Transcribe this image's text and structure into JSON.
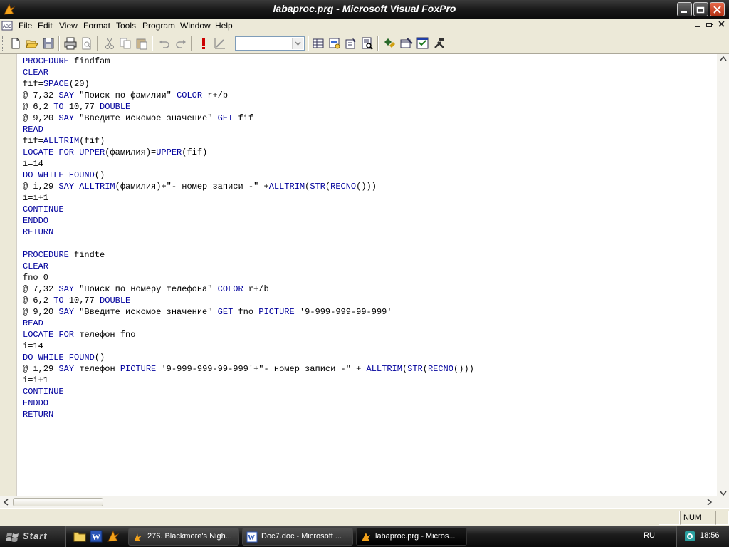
{
  "window": {
    "title": "labaproc.prg - Microsoft Visual FoxPro"
  },
  "menu": [
    "File",
    "Edit",
    "View",
    "Format",
    "Tools",
    "Program",
    "Window",
    "Help"
  ],
  "toolbar": {
    "icons": [
      "new-icon",
      "open-icon",
      "save-icon",
      "print-icon",
      "print-preview-icon",
      "cut-icon",
      "copy-icon",
      "paste-icon",
      "undo-icon",
      "redo-icon",
      "run-icon",
      "modify-form-icon",
      "database-icon",
      "form-wizard-icon",
      "report-icon",
      "report-preview-icon",
      "code-window-icon",
      "data-session-icon",
      "form-icon",
      "tools-icon"
    ],
    "combo_value": ""
  },
  "code": [
    [
      [
        "kw",
        "PROCEDURE"
      ],
      [
        "t",
        " findfam"
      ]
    ],
    [
      [
        "kw",
        "CLEAR"
      ]
    ],
    [
      [
        "t",
        "fif="
      ],
      [
        "kw",
        "SPACE"
      ],
      [
        "t",
        "(20)"
      ]
    ],
    [
      [
        "t",
        "@ 7,32 "
      ],
      [
        "kw",
        "SAY"
      ],
      [
        "t",
        " \"Поиск по фамилии\" "
      ],
      [
        "kw",
        "COLOR"
      ],
      [
        "t",
        " r+/b"
      ]
    ],
    [
      [
        "t",
        "@ 6,2 "
      ],
      [
        "kw",
        "TO"
      ],
      [
        "t",
        " 10,77 "
      ],
      [
        "kw",
        "DOUBLE"
      ]
    ],
    [
      [
        "t",
        "@ 9,20 "
      ],
      [
        "kw",
        "SAY"
      ],
      [
        "t",
        " \"Введите искомое значение\" "
      ],
      [
        "kw",
        "GET"
      ],
      [
        "t",
        " fif"
      ]
    ],
    [
      [
        "kw",
        "READ"
      ]
    ],
    [
      [
        "t",
        "fif="
      ],
      [
        "kw",
        "ALLTRIM"
      ],
      [
        "t",
        "(fif)"
      ]
    ],
    [
      [
        "kw",
        "LOCATE FOR UPPER"
      ],
      [
        "t",
        "(фамилия)="
      ],
      [
        "kw",
        "UPPER"
      ],
      [
        "t",
        "(fif)"
      ]
    ],
    [
      [
        "t",
        "i=14"
      ]
    ],
    [
      [
        "kw",
        "DO WHILE FOUND"
      ],
      [
        "t",
        "()"
      ]
    ],
    [
      [
        "t",
        "@ i,29 "
      ],
      [
        "kw",
        "SAY ALLTRIM"
      ],
      [
        "t",
        "(фамилия)+\"- номер записи -\" +"
      ],
      [
        "kw",
        "ALLTRIM"
      ],
      [
        "t",
        "("
      ],
      [
        "kw",
        "STR"
      ],
      [
        "t",
        "("
      ],
      [
        "kw",
        "RECNO"
      ],
      [
        "t",
        "()))"
      ]
    ],
    [
      [
        "t",
        "i=i+1"
      ]
    ],
    [
      [
        "kw",
        "CONTINUE"
      ]
    ],
    [
      [
        "kw",
        "ENDDO"
      ]
    ],
    [
      [
        "kw",
        "RETURN"
      ]
    ],
    [],
    [
      [
        "kw",
        "PROCEDURE"
      ],
      [
        "t",
        " findte"
      ]
    ],
    [
      [
        "kw",
        "CLEAR"
      ]
    ],
    [
      [
        "t",
        "fno=0"
      ]
    ],
    [
      [
        "t",
        "@ 7,32 "
      ],
      [
        "kw",
        "SAY"
      ],
      [
        "t",
        " \"Поиск по номеру телефона\" "
      ],
      [
        "kw",
        "COLOR"
      ],
      [
        "t",
        " r+/b"
      ]
    ],
    [
      [
        "t",
        "@ 6,2 "
      ],
      [
        "kw",
        "TO"
      ],
      [
        "t",
        " 10,77 "
      ],
      [
        "kw",
        "DOUBLE"
      ]
    ],
    [
      [
        "t",
        "@ 9,20 "
      ],
      [
        "kw",
        "SAY"
      ],
      [
        "t",
        " \"Введите искомое значение\" "
      ],
      [
        "kw",
        "GET"
      ],
      [
        "t",
        " fno "
      ],
      [
        "kw",
        "PICTURE"
      ],
      [
        "t",
        " '9-999-999-99-999'"
      ]
    ],
    [
      [
        "kw",
        "READ"
      ]
    ],
    [
      [
        "kw",
        "LOCATE FOR"
      ],
      [
        "t",
        " телефон=fno"
      ]
    ],
    [
      [
        "t",
        "i=14"
      ]
    ],
    [
      [
        "kw",
        "DO WHILE FOUND"
      ],
      [
        "t",
        "()"
      ]
    ],
    [
      [
        "t",
        "@ i,29 "
      ],
      [
        "kw",
        "SAY"
      ],
      [
        "t",
        " телефон "
      ],
      [
        "kw",
        "PICTURE"
      ],
      [
        "t",
        " '9-999-999-99-999'+\"- номер записи -\" + "
      ],
      [
        "kw",
        "ALLTRIM"
      ],
      [
        "t",
        "("
      ],
      [
        "kw",
        "STR"
      ],
      [
        "t",
        "("
      ],
      [
        "kw",
        "RECNO"
      ],
      [
        "t",
        "()))"
      ]
    ],
    [
      [
        "t",
        "i=i+1"
      ]
    ],
    [
      [
        "kw",
        "CONTINUE"
      ]
    ],
    [
      [
        "kw",
        "ENDDO"
      ]
    ],
    [
      [
        "kw",
        "RETURN"
      ]
    ]
  ],
  "statusbar": {
    "num": "NUM"
  },
  "taskbar": {
    "start": "Start",
    "tasks": [
      {
        "label": "276. Blackmore's Nigh...",
        "active": false
      },
      {
        "label": "Doc7.doc - Microsoft ...",
        "active": false
      },
      {
        "label": "labaproc.prg - Micros...",
        "active": true
      }
    ],
    "language": "RU",
    "clock": "18:56"
  },
  "colors": {
    "keyword": "#00009c",
    "text": "#000000"
  }
}
